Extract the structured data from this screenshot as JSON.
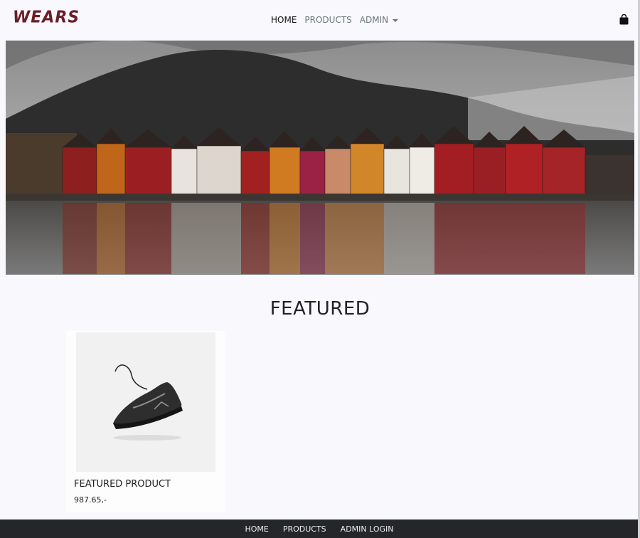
{
  "brand": {
    "name": "WEARS"
  },
  "nav": {
    "home": "HOME",
    "products": "PRODUCTS",
    "admin": "ADMIN"
  },
  "cart": {
    "icon": "shopping-bag-icon"
  },
  "hero": {
    "image": "bergen-waterfront-photo"
  },
  "featured": {
    "heading": "FEATURED",
    "product": {
      "name": "FEATURED PRODUCT",
      "price": "987.65,-",
      "image": "sneaker-photo"
    }
  },
  "footer": {
    "home": "HOME",
    "products": "PRODUCTS",
    "admin_login": "ADMIN LOGIN"
  },
  "colors": {
    "brand": "#6b1e26",
    "background": "#f9f8fc",
    "footer": "#242629"
  }
}
